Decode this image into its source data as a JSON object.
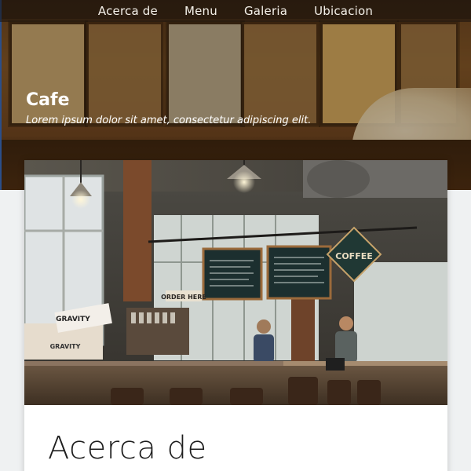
{
  "nav": {
    "items": [
      {
        "label": "Acerca de"
      },
      {
        "label": "Menu"
      },
      {
        "label": "Galeria"
      },
      {
        "label": "Ubicacion"
      }
    ]
  },
  "hero": {
    "title": "Cafe",
    "subtitle": "Lorem ipsum dolor sit amet, consectetur adipiscing elit."
  },
  "photo": {
    "signs": {
      "order_here": "ORDER HERE",
      "coffee": "COFFEE",
      "gravity_box_1": "GRAVITY",
      "gravity_box_2": "GRAVITY"
    }
  },
  "section": {
    "heading": "Acerca de"
  }
}
